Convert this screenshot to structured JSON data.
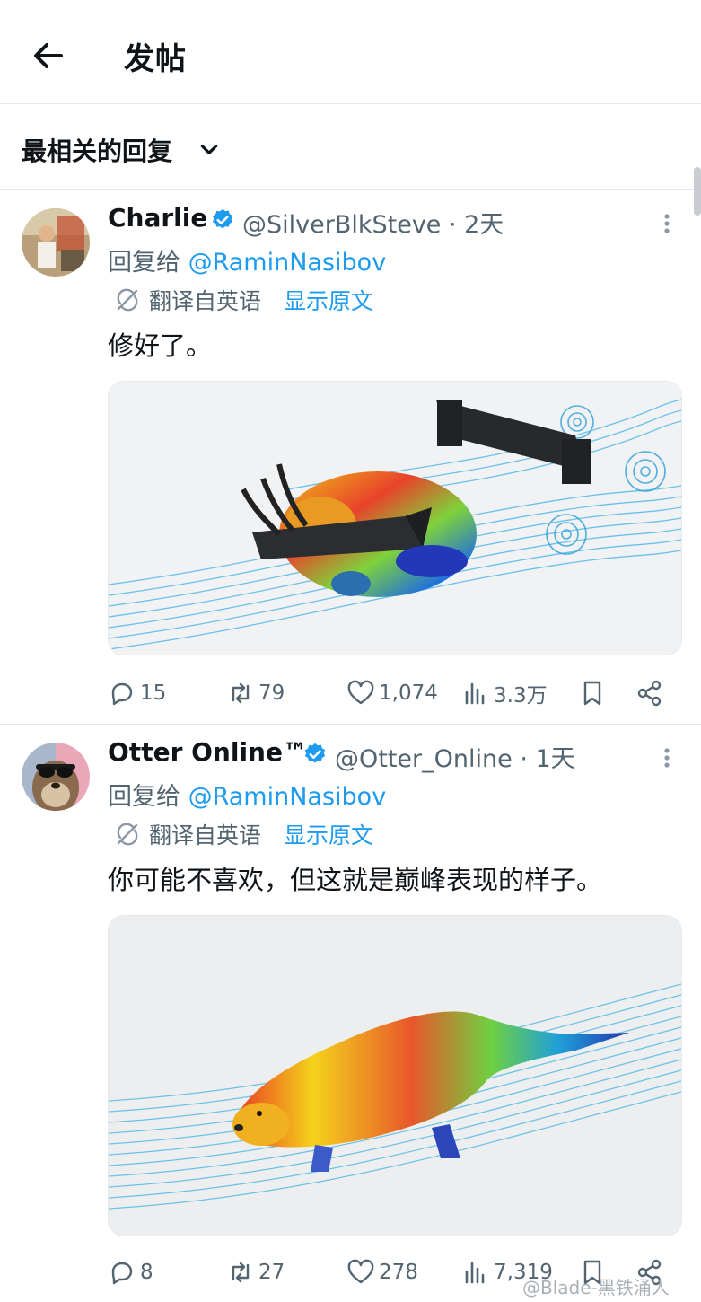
{
  "header": {
    "title": "发帖",
    "sort_label": "最相关的回复"
  },
  "posts": [
    {
      "name": "Charlie",
      "handle": "@SilverBlkSteve",
      "time": "· 2天",
      "reply_prefix": "回复给 ",
      "reply_to": "@RaminNasibov",
      "translated_from": "翻译自英语",
      "show_original": "显示原文",
      "text": "修好了。",
      "image_subject": "beaver-aero-simulation",
      "stats": {
        "replies": "15",
        "reposts": "79",
        "likes": "1,074",
        "views": "3.3万"
      }
    },
    {
      "name": "Otter Online™",
      "handle": "@Otter_Online",
      "time": "· 1天",
      "reply_prefix": "回复给 ",
      "reply_to": "@RaminNasibov",
      "translated_from": "翻译自英语",
      "show_original": "显示原文",
      "text": "你可能不喜欢，但这就是巅峰表现的样子。",
      "image_subject": "otter-aero-simulation",
      "stats": {
        "replies": "8",
        "reposts": "27",
        "likes": "278",
        "views": "7,319"
      }
    }
  ],
  "watermark": "@Blade-黑铁涌人",
  "colors": {
    "accent": "#1d9bf0",
    "muted": "#536471",
    "text": "#0f1419",
    "divider": "#e6e9ec"
  },
  "icons": [
    "back-arrow-icon",
    "chevron-down-icon",
    "verified-badge-icon",
    "more-icon",
    "translate-icon",
    "reply-icon",
    "repost-icon",
    "like-icon",
    "views-icon",
    "bookmark-icon",
    "share-icon"
  ]
}
